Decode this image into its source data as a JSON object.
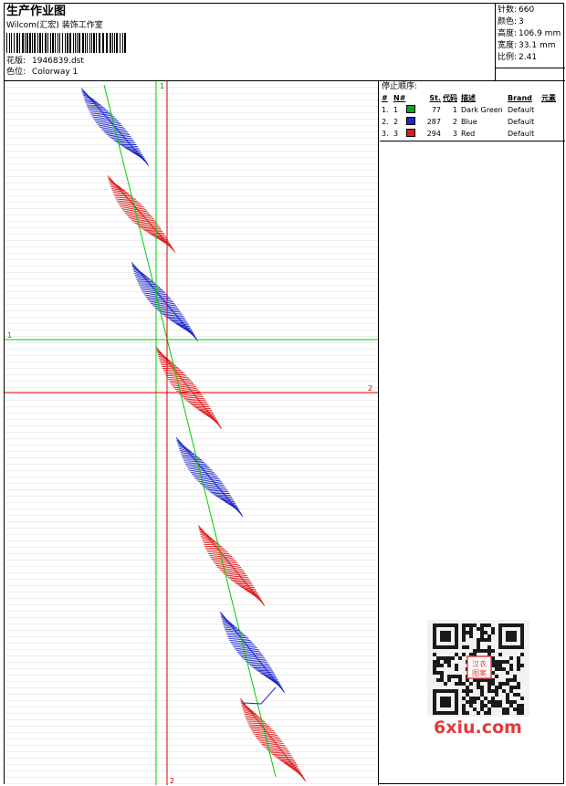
{
  "header": {
    "title": "生产作业图",
    "company": "Wilcom(汇宏) 装饰工作室",
    "design": {
      "label": "花版:",
      "value": "1946839.dst"
    },
    "colorway": {
      "label": "色位:",
      "value": "Colorway 1"
    }
  },
  "stats": {
    "stitches": {
      "label": "针数:",
      "value": "660"
    },
    "colors": {
      "label": "颜色:",
      "value": "3"
    },
    "height": {
      "label": "高度:",
      "value": "106.9 mm"
    },
    "width": {
      "label": "宽度:",
      "value": "33.1 mm"
    },
    "scale": {
      "label": "比例:",
      "value": "2.41"
    }
  },
  "guides": {
    "vertical_1_label": "1",
    "vertical_2_label": "2",
    "horizontal_1_label": "1",
    "horizontal_2_label": "2",
    "green": "#00cc00",
    "red": "#dd0000"
  },
  "color_table": {
    "title": "停止顺序:",
    "columns": [
      "#",
      "N#",
      "St.",
      "代码",
      "描述",
      "Brand",
      "元素"
    ],
    "rows": [
      {
        "idx": "1.",
        "no": "1",
        "color": "#1a9e1a",
        "st": "77",
        "code": "1",
        "desc": "Dark Green",
        "brand": "Default",
        "elem": ""
      },
      {
        "idx": "2.",
        "no": "2",
        "color": "#1b27c9",
        "st": "287",
        "code": "2",
        "desc": "Blue",
        "brand": "Default",
        "elem": ""
      },
      {
        "idx": "3.",
        "no": "3",
        "color": "#dd1b1b",
        "st": "294",
        "code": "3",
        "desc": "Red",
        "brand": "Default",
        "elem": ""
      }
    ]
  },
  "watermark": {
    "text": "6xiu.com",
    "stamp": "汉衣图案"
  },
  "colors": {
    "blue": "#1b27c9",
    "red": "#dd1b1b",
    "green": "#1a9e1a"
  }
}
